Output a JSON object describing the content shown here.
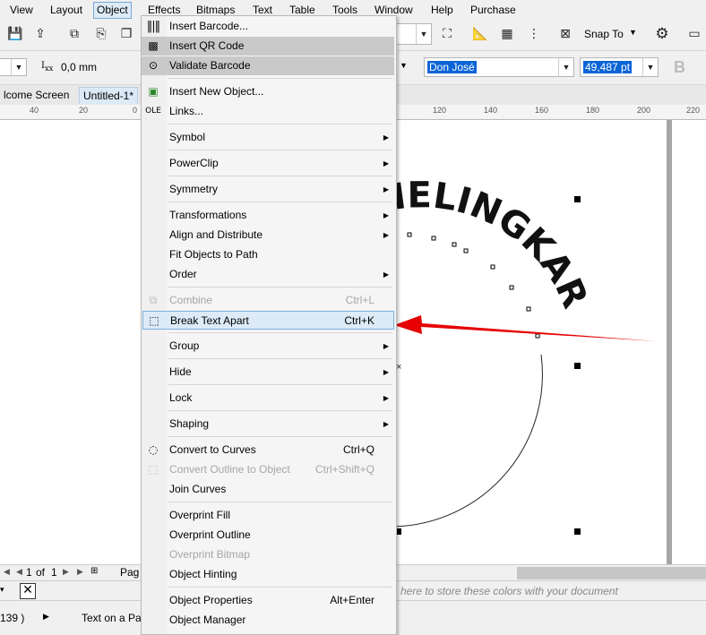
{
  "menubar": {
    "items": [
      "View",
      "Layout",
      "Object",
      "Effects",
      "Bitmaps",
      "Text",
      "Table",
      "Tools",
      "Window",
      "Help",
      "Purchase"
    ]
  },
  "toolbar1": {
    "snap_label": "Snap To"
  },
  "toolbar2": {
    "offset_value": "0,0 mm",
    "font_name": "Don José",
    "font_size": "49,487 pt",
    "bold": "B"
  },
  "tabs": [
    "lcome Screen",
    "Untitled-1*"
  ],
  "ruler": {
    "labels": [
      "40",
      "20",
      "0",
      "120",
      "140",
      "160",
      "180",
      "200",
      "220"
    ]
  },
  "canvas": {
    "curved_text": "IELINGKAR"
  },
  "pagebar": {
    "page_current": "1",
    "page_of": "of",
    "page_total": "1",
    "page_tab": "Pag"
  },
  "colorbar": {
    "hint": "here to store these colors with your document"
  },
  "statusbar": {
    "coords": "139 )",
    "object_info": "Text on a Pat"
  },
  "menu": {
    "items": [
      {
        "label": "Insert Barcode...",
        "icon": "barcode-icon"
      },
      {
        "label": "Insert QR Code",
        "icon": "qr-code-icon"
      },
      {
        "label": "Validate Barcode",
        "icon": "validate-barcode-icon"
      },
      {
        "label": "Insert New Object...",
        "icon": "insert-object-icon"
      },
      {
        "label": "Links...",
        "icon": "ole-links-icon"
      },
      {
        "label": "Symbol"
      },
      {
        "label": "PowerClip"
      },
      {
        "label": "Symmetry"
      },
      {
        "label": "Transformations"
      },
      {
        "label": "Align and Distribute"
      },
      {
        "label": "Fit Objects to Path"
      },
      {
        "label": "Order"
      },
      {
        "label": "Combine",
        "shortcut": "Ctrl+L",
        "icon": "combine-icon"
      },
      {
        "label": "Break Text Apart",
        "shortcut": "Ctrl+K",
        "icon": "break-text-apart-icon"
      },
      {
        "label": "Group"
      },
      {
        "label": "Hide"
      },
      {
        "label": "Lock"
      },
      {
        "label": "Shaping"
      },
      {
        "label": "Convert to Curves",
        "shortcut": "Ctrl+Q",
        "icon": "convert-curves-icon"
      },
      {
        "label": "Convert Outline to Object",
        "shortcut": "Ctrl+Shift+Q",
        "icon": "convert-outline-icon"
      },
      {
        "label": "Join Curves"
      },
      {
        "label": "Overprint Fill"
      },
      {
        "label": "Overprint Outline"
      },
      {
        "label": "Overprint Bitmap"
      },
      {
        "label": "Object Hinting"
      },
      {
        "label": "Object Properties",
        "shortcut": "Alt+Enter"
      },
      {
        "label": "Object Manager"
      }
    ]
  },
  "colors": {
    "highlight": "#dcebf7",
    "arrow": "#e60000",
    "selection": "#0a64d6"
  }
}
